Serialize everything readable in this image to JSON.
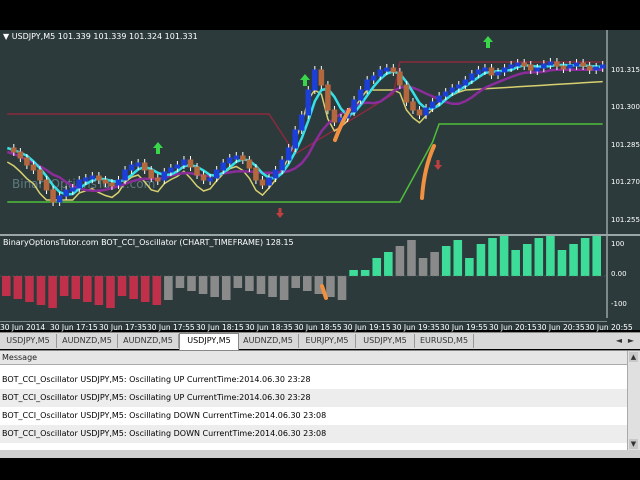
{
  "chart": {
    "symbol_header": "▼ USDJPY,M5  101.339 101.339 101.324 101.331",
    "watermark": "BinaryOptionsTutor.com",
    "price_labels": [
      "101.315",
      "101.300",
      "101.285",
      "101.270",
      "101.255"
    ],
    "oscillator_header": "BinaryOptionsTutor.com BOT_CCI_Oscillator (CHART_TIMEFRAME) 128.15",
    "oscillator_labels": [
      "100",
      "0.00",
      "-100"
    ],
    "time_labels": [
      "30 Jun 2014",
      "30 Jun 17:15",
      "30 Jun 17:35",
      "30 Jun 17:55",
      "30 Jun 18:15",
      "30 Jun 18:35",
      "30 Jun 18:55",
      "30 Jun 19:15",
      "30 Jun 19:35",
      "30 Jun 19:55",
      "30 Jun 20:15",
      "30 Jun 20:35",
      "30 Jun 20:55"
    ],
    "colors": {
      "background": "#2c3a3b",
      "bull_candle": "#1c3fd8",
      "bear_candle": "#b4683e",
      "cyan_line": "#36e0e8",
      "purple_line": "#8a2c9a",
      "yellow_line": "#d8d070",
      "green_line": "#4fbf3a",
      "maroon_line": "#8a2a3e",
      "osc_up": "#3ddc98",
      "osc_down": "#c0304a",
      "osc_neutral": "#8a8a8a",
      "arrow_up": "#3ad64a",
      "arrow_down": "#c04040",
      "signal_orange": "#f09040"
    }
  },
  "tabs": {
    "items": [
      "USDJPY,M5",
      "AUDNZD,M5",
      "AUDNZD,M5",
      "USDJPY,M5",
      "AUDNZD,M5",
      "EURJPY,M5",
      "USDJPY,M5",
      "EURUSD,M5"
    ],
    "active_index": 3,
    "scroll_left": "◄",
    "scroll_right": "►"
  },
  "terminal": {
    "header": "Message",
    "rows": [
      "BOT_CCI_Oscillator USDJPY,M5: Oscillating UP CurrentTime:2014.06.30 23:28",
      "BOT_CCI_Oscillator USDJPY,M5: Oscillating UP CurrentTime:2014.06.30 23:28",
      "BOT_CCI_Oscillator USDJPY,M5: Oscillating DOWN CurrentTime:2014.06.30 23:08",
      "BOT_CCI_Oscillator USDJPY,M5: Oscillating DOWN CurrentTime:2014.06.30 23:08"
    ]
  }
}
